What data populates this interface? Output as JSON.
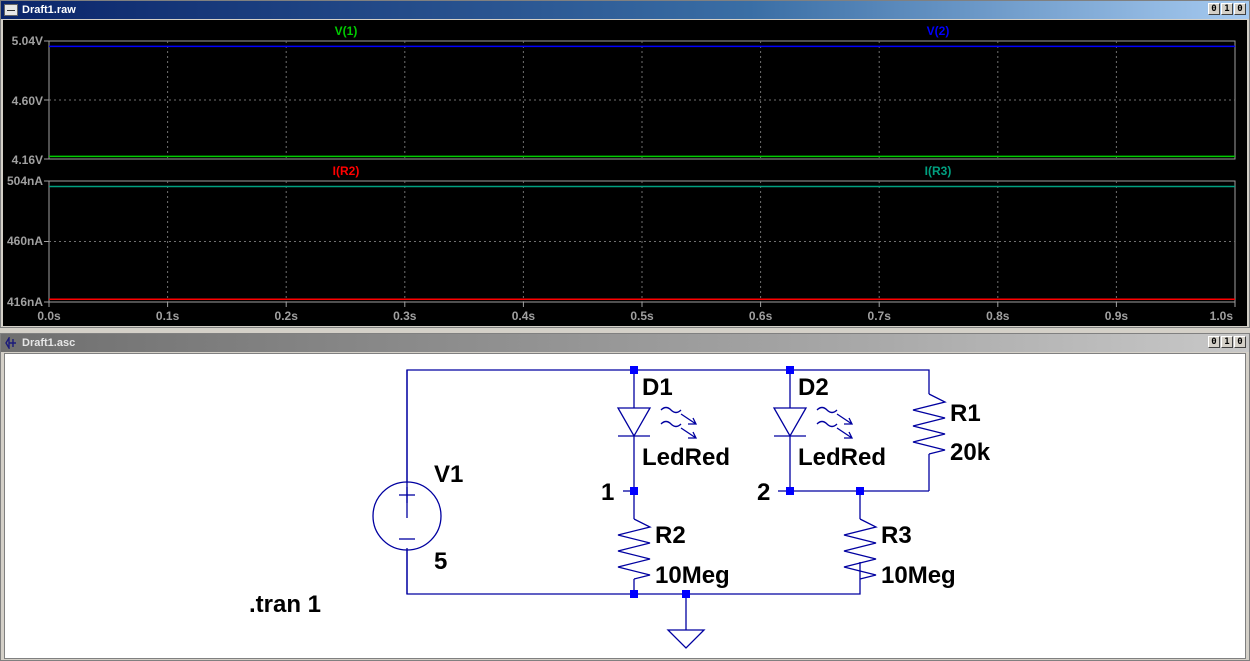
{
  "waveform_window": {
    "title": "Draft1.raw",
    "controls": [
      "0",
      "1",
      "0"
    ],
    "top_pane": {
      "y_ticks": [
        "5.04V",
        "4.60V",
        "4.16V"
      ],
      "traces": [
        {
          "name": "V(1)",
          "color": "#00cc00"
        },
        {
          "name": "V(2)",
          "color": "#0000ff"
        }
      ]
    },
    "bottom_pane": {
      "y_ticks": [
        "504nA",
        "460nA",
        "416nA"
      ],
      "traces": [
        {
          "name": "I(R2)",
          "color": "#ff0000"
        },
        {
          "name": "I(R3)",
          "color": "#00a080"
        }
      ]
    },
    "x_ticks": [
      "0.0s",
      "0.1s",
      "0.2s",
      "0.3s",
      "0.4s",
      "0.5s",
      "0.6s",
      "0.7s",
      "0.8s",
      "0.9s",
      "1.0s"
    ]
  },
  "chart_data": [
    {
      "type": "line",
      "x": [
        0,
        1
      ],
      "xlim": [
        0,
        1
      ],
      "ylim": [
        4.16,
        5.04
      ],
      "series": [
        {
          "name": "V(1)",
          "color": "#00cc00",
          "y": [
            4.18,
            4.18
          ]
        },
        {
          "name": "V(2)",
          "color": "#0000ff",
          "y": [
            5.0,
            5.0
          ]
        }
      ]
    },
    {
      "type": "line",
      "x": [
        0,
        1
      ],
      "xlim": [
        0,
        1
      ],
      "ylim": [
        416,
        504
      ],
      "series": [
        {
          "name": "I(R2)",
          "color": "#ff0000",
          "y": [
            418,
            418
          ]
        },
        {
          "name": "I(R3)",
          "color": "#00a080",
          "y": [
            500,
            500
          ]
        }
      ]
    }
  ],
  "schematic_window": {
    "title": "Draft1.asc",
    "controls": [
      "0",
      "1",
      "0"
    ],
    "labels": {
      "d1_name": "D1",
      "d1_value": "LedRed",
      "d2_name": "D2",
      "d2_value": "LedRed",
      "r1_name": "R1",
      "r1_value": "20k",
      "r2_name": "R2",
      "r2_value": "10Meg",
      "r3_name": "R3",
      "r3_value": "10Meg",
      "v1_name": "V1",
      "v1_value": "5",
      "net1": "1",
      "net2": "2",
      "directive": ".tran 1"
    },
    "colors": {
      "wire": "#0000a0",
      "node": "#0000ff"
    }
  }
}
